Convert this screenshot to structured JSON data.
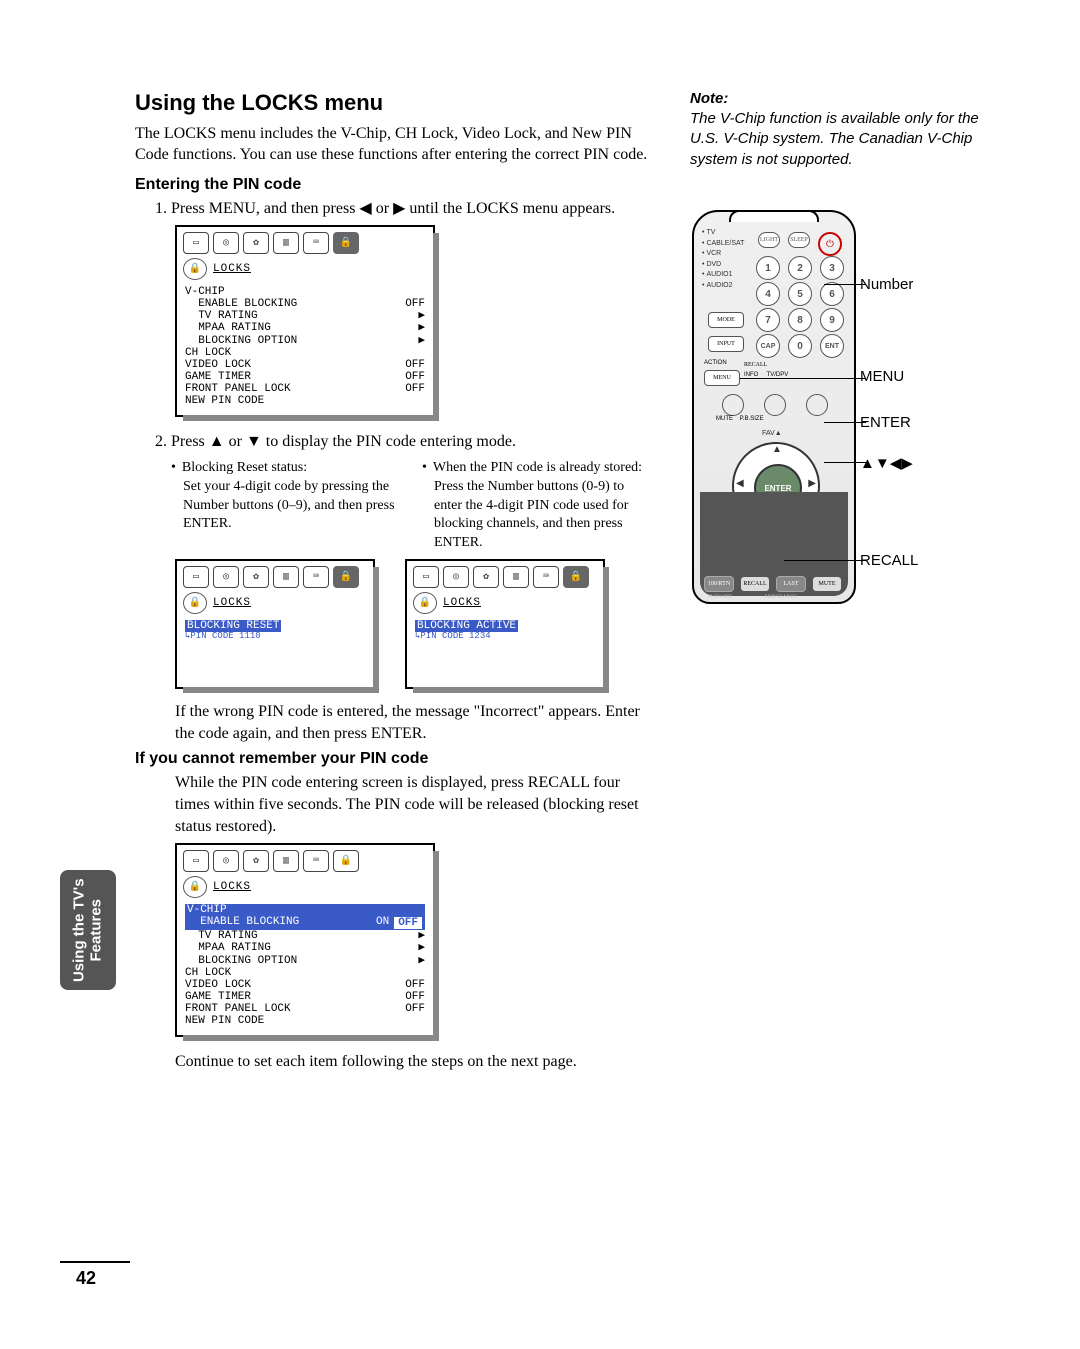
{
  "title": "Using the LOCKS menu",
  "intro": "The LOCKS menu includes the V-Chip, CH Lock, Video Lock, and New PIN Code functions. You can use these functions after entering the correct PIN code.",
  "section_enter": "Entering the PIN code",
  "step1_pre": "1.  Press MENU, and then press ",
  "step1_mid": " or ",
  "step1_post": " until the LOCKS menu appears.",
  "arrow_left": "◀",
  "arrow_right": "▶",
  "arrow_up": "▲",
  "arrow_down": "▼",
  "step2_pre": "2.  Press ",
  "step2_mid": " or ",
  "step2_post": " to display the PIN code entering mode.",
  "bullet_left_head": "Blocking Reset status:",
  "bullet_left_body": "Set your 4-digit code by pressing the Number buttons (0–9), and then press ENTER.",
  "bullet_right_head": "When the PIN code is already stored:",
  "bullet_right_body": "Press the Number buttons (0-9) to enter the 4-digit PIN code used for blocking channels, and then press ENTER.",
  "wrong_pin": "If the wrong PIN code is entered, the message \"Incorrect\" appears. Enter the code again, and then press ENTER.",
  "section_forgot": "If you cannot remember your PIN code",
  "forgot_body": "While the PIN code entering screen is displayed, press RECALL four times within five seconds. The PIN code will be released (blocking reset status restored).",
  "continue_line": "Continue to set each item following the steps on the next page.",
  "note_head": "Note:",
  "note_body": "The V-Chip function is available only for the U.S. V-Chip system. The Canadian V-Chip system is not supported.",
  "side_tab_l1": "Using the TV's",
  "side_tab_l2": "Features",
  "page_number": "42",
  "osd": {
    "label": "LOCKS",
    "items": {
      "vchip": "V-CHIP",
      "enable": "ENABLE BLOCKING",
      "tvrating": "TV RATING",
      "mpaa": "MPAA RATING",
      "blockopt": "BLOCKING OPTION",
      "chlock": "CH LOCK",
      "videolock": "VIDEO LOCK",
      "gametimer": "GAME TIMER",
      "frontlock": "FRONT PANEL LOCK",
      "newpin": "NEW PIN CODE"
    },
    "vals": {
      "off": "OFF",
      "on": "ON",
      "arrow": "▶"
    },
    "reset_line": "BLOCKING RESET",
    "reset_sub": "PIN CODE 1110",
    "active_line": "BLOCKING ACTIVE",
    "active_sub": "PIN CODE 1234"
  },
  "remote": {
    "devs": [
      "TV",
      "CABLE/SAT",
      "VCR",
      "DVD",
      "AUDIO1",
      "AUDIO2"
    ],
    "mode": "MODE",
    "enter_btn": "ENTER",
    "callouts": {
      "number": "Number",
      "menu": "MENU",
      "enter": "ENTER",
      "arrows": "▲▼◀▶",
      "recall": "RECALL"
    }
  }
}
